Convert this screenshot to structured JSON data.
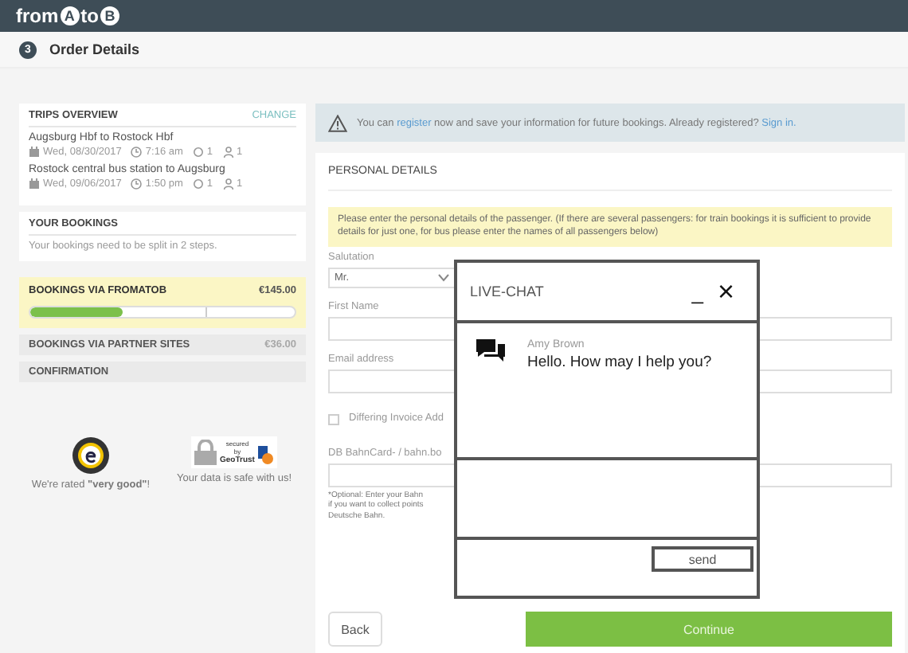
{
  "header": {
    "logo": [
      {
        "kind": "word",
        "text": "from"
      },
      {
        "kind": "pin",
        "text": "A"
      },
      {
        "kind": "word",
        "text": "to"
      },
      {
        "kind": "pin",
        "text": "B"
      }
    ]
  },
  "step": {
    "number": "3",
    "title": "Order Details"
  },
  "sidebar": {
    "trips": {
      "title": "TRIPS OVERVIEW",
      "action": "CHANGE",
      "items": [
        {
          "route": "Augsburg Hbf to Rostock Hbf",
          "date": "Wed, 08/30/2017",
          "time": "7:16 am",
          "changes": "1",
          "passengers": "1"
        },
        {
          "route": "Rostock central bus station to Augsburg",
          "date": "Wed, 09/06/2017",
          "time": "1:50 pm",
          "changes": "1",
          "passengers": "1"
        }
      ]
    },
    "bookings": {
      "title": "YOUR BOOKINGS",
      "text": "Your bookings need to be split in 2 steps."
    },
    "sections": [
      {
        "title": "BOOKINGS VIA FROMATOB",
        "price": "€145.00",
        "selected": true,
        "level": 0.35
      },
      {
        "title": "BOOKINGS VIA PARTNER SITES",
        "price": "€36.00",
        "selected": false
      },
      {
        "title": "CONFIRMATION",
        "selected": false
      }
    ],
    "badges": [
      {
        "kind": "rating",
        "text": "We're rated **\"very good\"**!"
      },
      {
        "kind": "secure",
        "text": "Your data is safe with us!",
        "seal": [
          "secured",
          "by",
          "GeoTrust"
        ]
      }
    ]
  },
  "notice": {
    "text_before": "You can ",
    "link": "register",
    "text_middle": " now and save your information for future bookings. Already registered? ",
    "link_2": "Sign in."
  },
  "form": {
    "title": "PERSONAL DETAILS",
    "hint": "Please enter the personal details of the passenger. (If there are several passengers: for train bookings it is sufficient to provide details for just one, for bus please enter the names of all passengers below)",
    "fields": [
      {
        "kind": "select",
        "label": "Salutation",
        "value": "Mr."
      },
      {
        "kind": "text",
        "label": "First Name"
      },
      {
        "kind": "text",
        "label": "Email address"
      },
      {
        "kind": "checkbox",
        "label": "Differing Invoice Add",
        "checked": false
      },
      {
        "kind": "text",
        "label": "DB BahnCard- / bahn.bo",
        "note": [
          "*Optional: Enter your Bahn",
          "if you want to collect points",
          "Deutsche Bahn."
        ]
      }
    ],
    "back": "Back",
    "continue": "Continue"
  },
  "chat": {
    "title": "LIVE-CHAT",
    "minimize": "_",
    "close": "×",
    "sender": "Amy Brown",
    "message": "Hello. How may I help you?",
    "send": "send"
  }
}
